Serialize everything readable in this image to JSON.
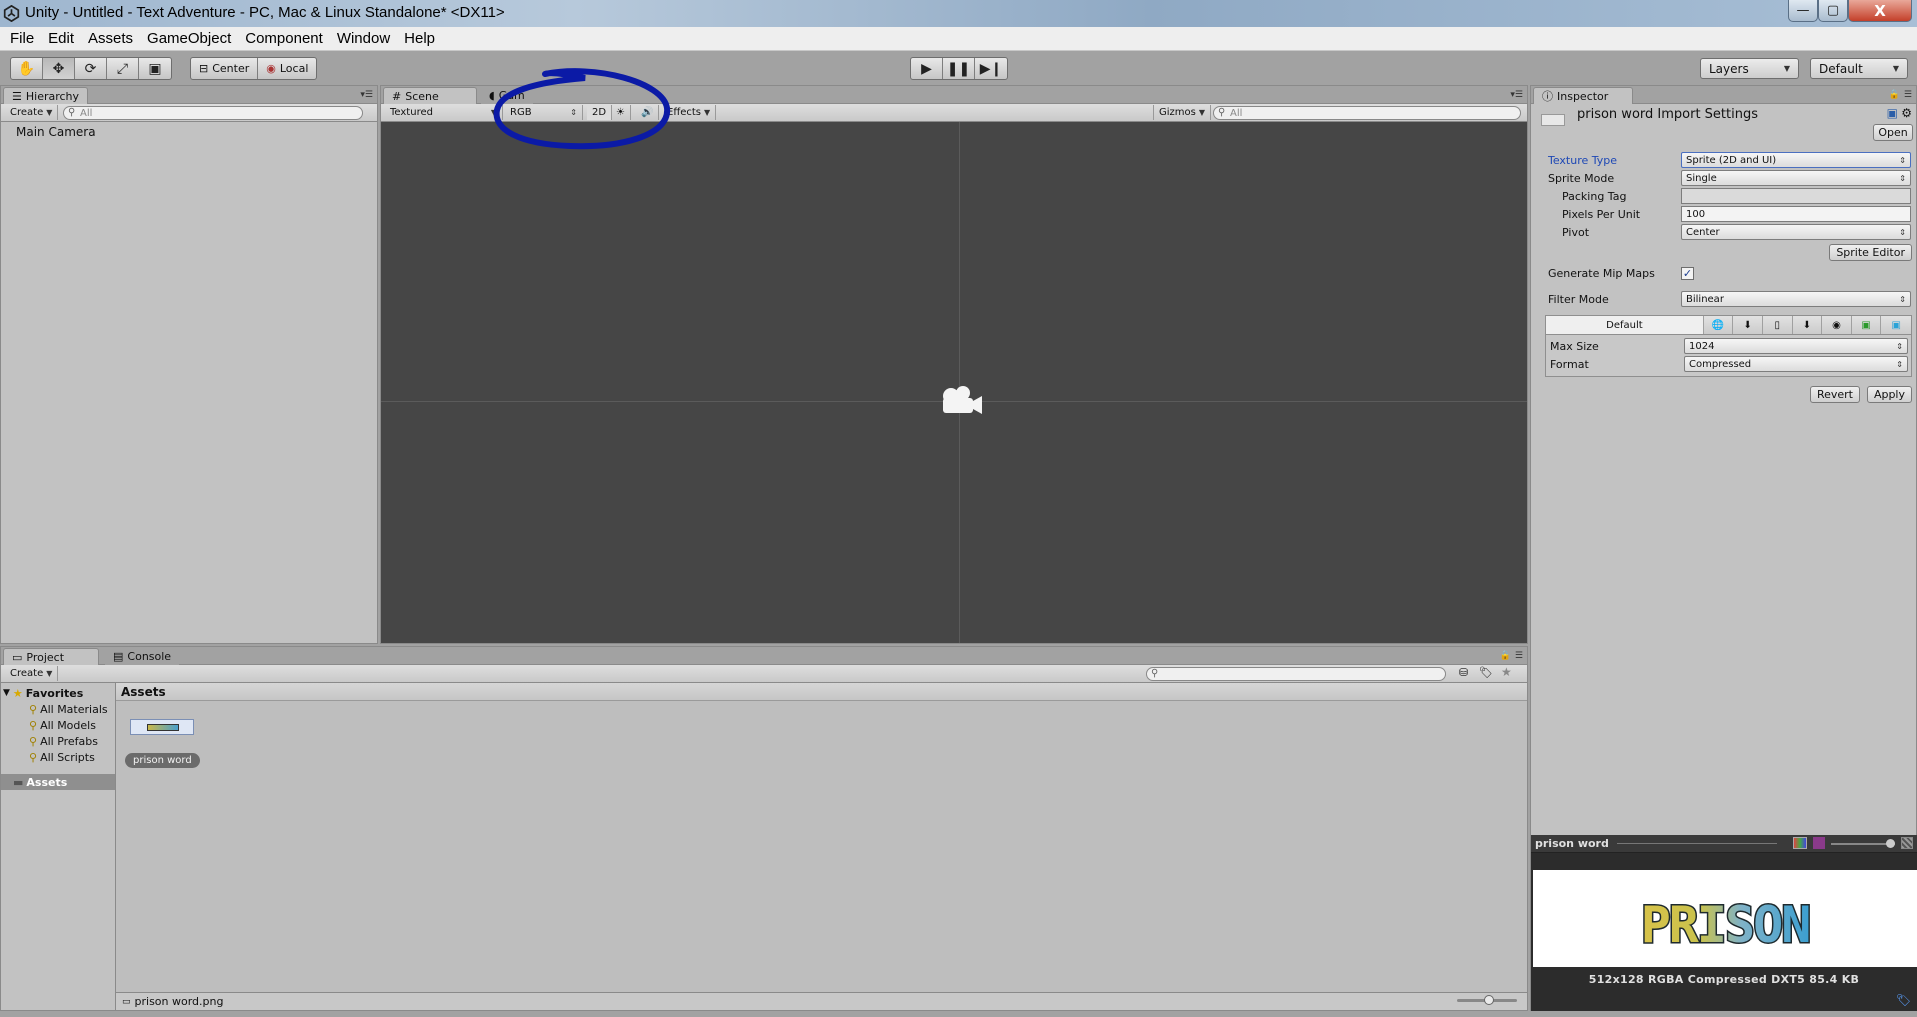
{
  "window": {
    "title": "Unity - Untitled - Text Adventure - PC, Mac & Linux Standalone* <DX11>",
    "controls": {
      "minimize": "—",
      "maximize": "▢",
      "close": "X"
    }
  },
  "menu": [
    "File",
    "Edit",
    "Assets",
    "GameObject",
    "Component",
    "Window",
    "Help"
  ],
  "toolbar": {
    "tools": [
      "hand-tool",
      "move-tool",
      "rotate-tool",
      "scale-tool",
      "rect-tool"
    ],
    "pivot_mode": "Center",
    "pivot_rotation": "Local",
    "layers": "Layers",
    "layout": "Default"
  },
  "hierarchy": {
    "tab": "Hierarchy",
    "create": "Create",
    "search_placeholder": "All",
    "items": [
      "Main Camera"
    ]
  },
  "scene": {
    "tabs": [
      "Scene",
      "Game"
    ],
    "shading_mode": "Textured",
    "render_mode": "RGB",
    "mode_2d": "2D",
    "effects": "Effects",
    "gizmos": "Gizmos",
    "search_placeholder": "All",
    "annotation_color": "#0b1aa6"
  },
  "inspector": {
    "tab": "Inspector",
    "asset_title": "prison word Import Settings",
    "open_button": "Open",
    "fields": {
      "texture_type": {
        "label": "Texture Type",
        "value": "Sprite (2D and UI)"
      },
      "sprite_mode": {
        "label": "Sprite Mode",
        "value": "Single"
      },
      "packing_tag": {
        "label": "Packing Tag",
        "value": ""
      },
      "pixels_per_unit": {
        "label": "Pixels Per Unit",
        "value": "100"
      },
      "pivot": {
        "label": "Pivot",
        "value": "Center"
      },
      "generate_mip_maps": {
        "label": "Generate Mip Maps",
        "checked": true
      },
      "filter_mode": {
        "label": "Filter Mode",
        "value": "Bilinear"
      }
    },
    "sprite_editor_button": "Sprite Editor",
    "platform": {
      "default_tab": "Default",
      "max_size": {
        "label": "Max Size",
        "value": "1024"
      },
      "format": {
        "label": "Format",
        "value": "Compressed"
      }
    },
    "revert_button": "Revert",
    "apply_button": "Apply"
  },
  "preview": {
    "title": "prison word",
    "image_text": "PRISON",
    "info": "512x128  RGBA Compressed DXT5   85.4 KB"
  },
  "project": {
    "tabs": [
      "Project",
      "Console"
    ],
    "create": "Create",
    "favorites_label": "Favorites",
    "favorites": [
      "All Materials",
      "All Models",
      "All Prefabs",
      "All Scripts"
    ],
    "assets_folder": "Assets",
    "assets_header": "Assets",
    "asset_items": [
      {
        "name": "prison word"
      }
    ],
    "status_file": "prison word.png"
  }
}
